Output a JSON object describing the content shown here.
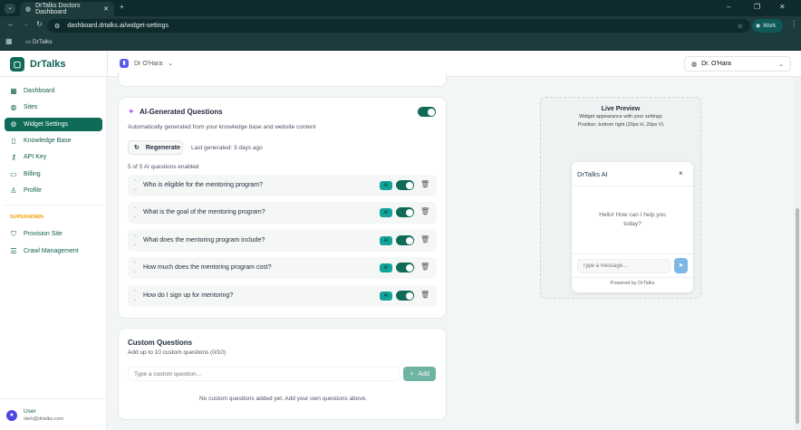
{
  "browser": {
    "tab_title": "DrTalks Doctors Dashboard",
    "url": "dashboard.drtalks.ai/widget-settings",
    "bookmark": "DrTalks",
    "profile": "Work"
  },
  "app": {
    "logo": "DrTalks",
    "site_selector": "Dr O'Hara",
    "account_selector": "Dr. O'Hara"
  },
  "sidebar": {
    "items": [
      {
        "label": "Dashboard",
        "icon": "grid"
      },
      {
        "label": "Sites",
        "icon": "globe"
      },
      {
        "label": "Widget Settings",
        "icon": "gear"
      },
      {
        "label": "Knowledge Base",
        "icon": "book"
      },
      {
        "label": "API Key",
        "icon": "key"
      },
      {
        "label": "Billing",
        "icon": "card"
      },
      {
        "label": "Profile",
        "icon": "user"
      }
    ],
    "section": "SUPERADMIN",
    "admin_items": [
      {
        "label": "Provision Site",
        "icon": "shield"
      },
      {
        "label": "Crawl Management",
        "icon": "database"
      }
    ],
    "user": {
      "name": "User",
      "email": "oleh@drtalks.com"
    }
  },
  "ai_questions": {
    "title": "AI-Generated Questions",
    "enabled": true,
    "subtitle": "Automatically generated from your knowledge base and website content",
    "regenerate": "Regenerate",
    "last_generated": "Last generated: 3 days ago",
    "count": "5 of 5 AI questions enabled",
    "badge": "AI",
    "questions": [
      "Who is eligible for the mentoring program?",
      "What is the goal of the mentoring program?",
      "What does the mentoring program include?",
      "How much does the mentoring program cost?",
      "How do I sign up for mentoring?"
    ]
  },
  "custom_questions": {
    "title": "Custom Questions",
    "subtitle": "Add up to 10 custom questions (0/10)",
    "placeholder": "Type a custom question...",
    "add": "Add",
    "empty": "No custom questions added yet. Add your own questions above."
  },
  "preview": {
    "title": "Live Preview",
    "subtitle": "Widget appearance with your settings",
    "position": "Position: bottom right (20px H, 20px V)",
    "widget_title": "DrTalks AI",
    "greeting": "Hello! How can I help you today?",
    "input_placeholder": "Type a message...",
    "powered": "Powered by DrTalks",
    "send_color": "#7fb6e6"
  },
  "colors": {
    "brand": "#0f6b57",
    "accent": "#14a399",
    "superadmin": "#f59e0b"
  }
}
